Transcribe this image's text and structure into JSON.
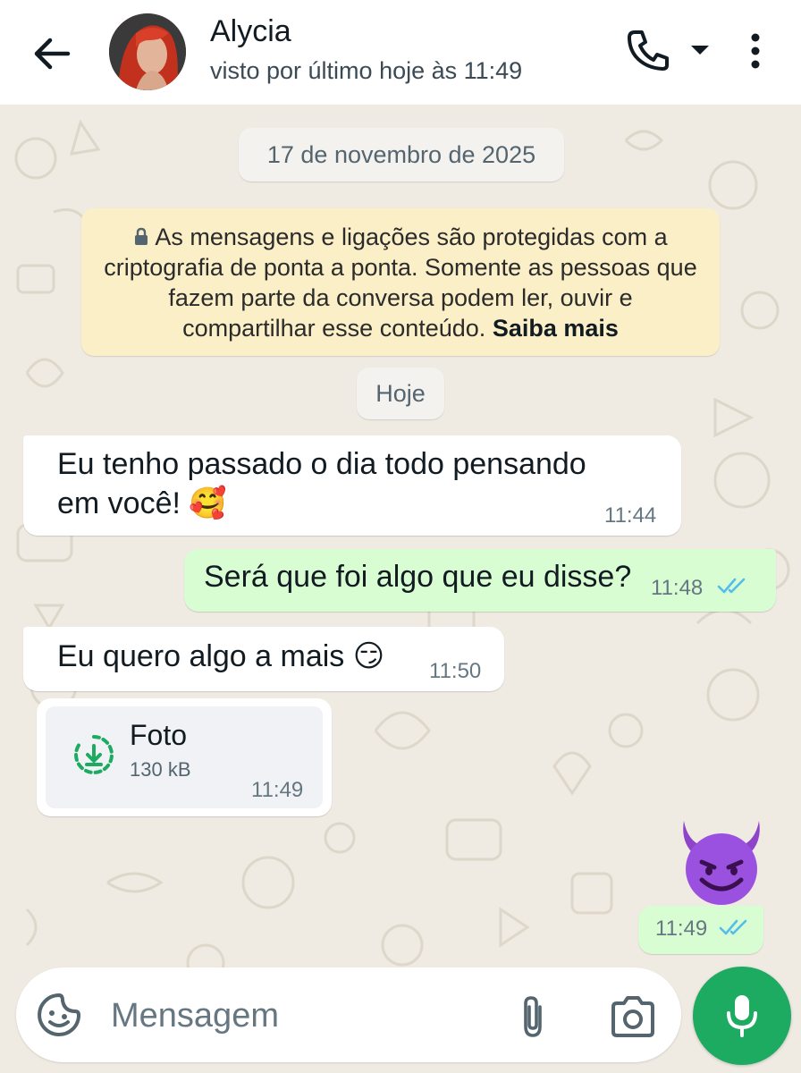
{
  "header": {
    "contact_name": "Alycia",
    "status": "visto por último hoje às 11:49",
    "icons": [
      "back-arrow-icon",
      "phone-icon",
      "dropdown-caret-icon",
      "more-vert-icon"
    ]
  },
  "chat": {
    "date_label": "17 de novembro de 2025",
    "encryption_notice": "As mensagens e ligações são protegidas com a criptografia de ponta a ponta. Somente as pessoas que fazem parte da conversa podem ler, ouvir e compartilhar esse conteúdo.",
    "encryption_link": "Saiba mais",
    "day_label": "Hoje",
    "messages": [
      {
        "direction": "in",
        "line1": "Eu tenho passado o dia todo pensando",
        "line2": "em você! 🥰",
        "time": "11:44"
      },
      {
        "direction": "out",
        "text": "Será que foi algo que eu disse?",
        "time": "11:48",
        "status": "read"
      },
      {
        "direction": "in",
        "text": "Eu quero algo a mais 😏",
        "time": "11:50"
      },
      {
        "direction": "in",
        "type": "photo",
        "title": "Foto",
        "size": "130 kB",
        "time": "11:49"
      },
      {
        "direction": "out",
        "type": "emoji",
        "emoji": "devil-smiling-emoji",
        "time": "11:49",
        "status": "read"
      }
    ]
  },
  "composer": {
    "placeholder": "Mensagem",
    "icons": [
      "sticker-icon",
      "attach-icon",
      "camera-icon",
      "mic-icon"
    ]
  },
  "colors": {
    "accent_green": "#1daa61",
    "outgoing_bubble": "#d9fdd3",
    "read_ticks": "#53bdeb",
    "notice_bg": "#fbefc7"
  }
}
